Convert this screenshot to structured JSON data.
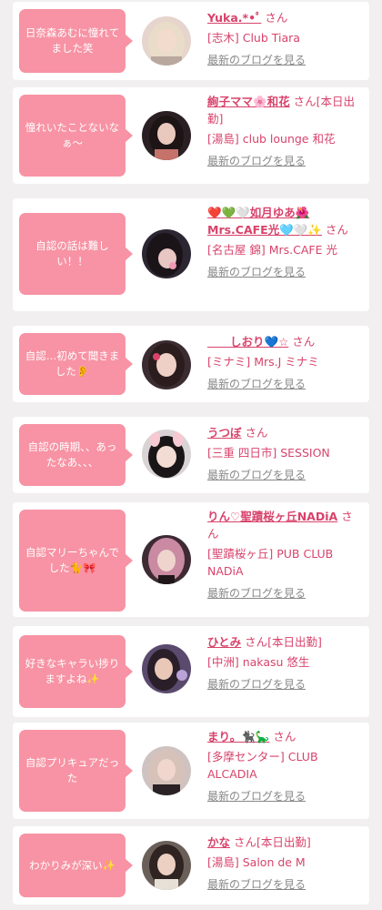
{
  "posts": [
    {
      "bubble": "日奈森あむに憧れてました笑",
      "name": "Yuka.*•ﾟ",
      "suffix": "さん",
      "shop": "[志木] Club Tiara",
      "blog_link": "最新のブログを見る",
      "avatar_colors": {
        "bg": "#e6d5cc",
        "hair": "#e9dcc8",
        "skin": "#f2dacc"
      }
    },
    {
      "bubble": "憧れいたことないなぁ〜",
      "name": "絢子ママ🌸和花",
      "suffix": "さん[本日出勤]",
      "shop": "[湯島] club lounge 和花",
      "blog_link": "最新のブログを見る",
      "avatar_colors": {
        "bg": "#2a2024",
        "hair": "#1d1416",
        "skin": "#e9c9bd"
      }
    },
    {
      "bubble": "自認の話は難しい！！",
      "name": "❤️💚🤍如月ゆあ🌺Mrs.CAFE光🩵🤍✨",
      "suffix": "さん",
      "shop": "[名古屋 錦] Mrs.CAFE 光",
      "blog_link": "最新のブログを見る",
      "avatar_colors": {
        "bg": "#2c2633",
        "hair": "#1a1418",
        "skin": "#e8c6c4"
      }
    },
    {
      "bubble": "自認…初めて聞きました👂",
      "name": "　　しおり💙☆",
      "suffix": "さん",
      "shop": "[ミナミ] Mrs.J ミナミ",
      "blog_link": "最新のブログを見る",
      "avatar_colors": {
        "bg": "#3a2c30",
        "hair": "#2b1d1e",
        "skin": "#efd0c6"
      }
    },
    {
      "bubble": "自認の時期、、あったなあ、、、",
      "name": "うつぼ",
      "suffix": "さん",
      "shop": "[三重 四日市] SESSION",
      "blog_link": "最新のブログを見る",
      "avatar_colors": {
        "bg": "#d9d3d6",
        "hair": "#1a1516",
        "skin": "#f3dcd4"
      }
    },
    {
      "bubble": "自認マリーちゃんでした🐈🎀",
      "name": "りん♡聖蹟桜ヶ丘NADiA",
      "suffix": "さん",
      "shop": "[聖蹟桜ヶ丘] PUB CLUB NADiA",
      "blog_link": "最新のブログを見る",
      "avatar_colors": {
        "bg": "#3d2a33",
        "hair": "#c98aa2",
        "skin": "#efd4cd"
      }
    },
    {
      "bubble": "好きなキャラい捗りますよね✨",
      "name": "ひとみ",
      "suffix": "さん[本日出勤]",
      "shop": "[中洲] nakasu 悠生",
      "blog_link": "最新のブログを見る",
      "avatar_colors": {
        "bg": "#5a4a6e",
        "hair": "#2a1f28",
        "skin": "#e9c8b8"
      }
    },
    {
      "bubble": "自認プリキュアだった",
      "name": "まり。🐈‍⬛🦕",
      "suffix": "さん",
      "shop": "[多摩センター] CLUB ALCADIA",
      "blog_link": "最新のブログを見る",
      "avatar_colors": {
        "bg": "#cfc3c1",
        "hair": "#d6c2b8",
        "skin": "#f0d6cc"
      }
    },
    {
      "bubble": "わかりみが深い✨",
      "name": "かな",
      "suffix": "さん[本日出勤]",
      "shop": "[湯島] Salon de M",
      "blog_link": "最新のブログを見る",
      "avatar_colors": {
        "bg": "#6b5f5a",
        "hair": "#2f2422",
        "skin": "#ecd0c2"
      }
    }
  ]
}
